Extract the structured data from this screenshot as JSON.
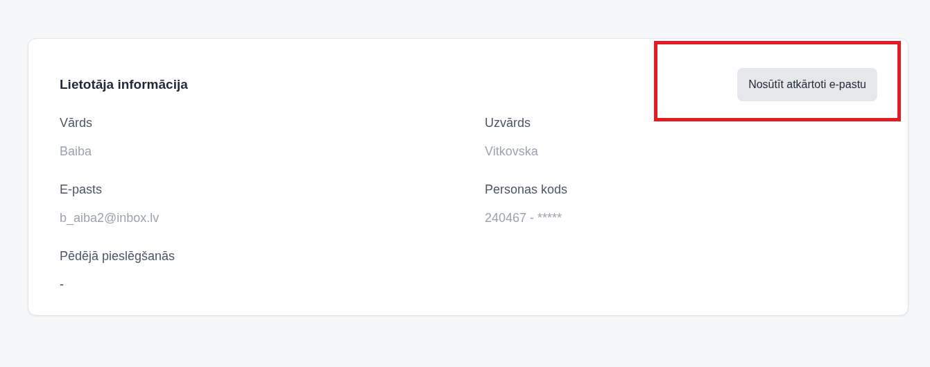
{
  "card": {
    "title": "Lietotāja informācija",
    "action_button": {
      "label": "Nosūtīt atkārtoti e-pastu",
      "highlighted": true
    },
    "fields": [
      {
        "label": "Vārds",
        "value": "Baiba",
        "faded": true
      },
      {
        "label": "Uzvārds",
        "value": "Vitkovska",
        "faded": true
      },
      {
        "label": "E-pasts",
        "value": "b_aiba2@inbox.lv",
        "faded": true
      },
      {
        "label": "Personas kods",
        "value": "240467 - *****",
        "faded": true
      },
      {
        "label": "Pēdējā pieslēgšanās",
        "value": "-",
        "faded": false
      }
    ]
  }
}
